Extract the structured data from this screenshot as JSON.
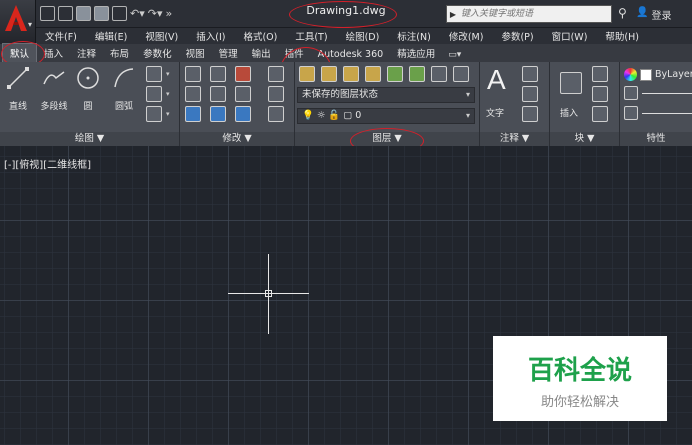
{
  "title_bar": {
    "document_title": "Drawing1.dwg",
    "search_placeholder": "键入关键字或短语",
    "login_label": "登录"
  },
  "menu": [
    "文件(F)",
    "编辑(E)",
    "视图(V)",
    "插入(I)",
    "格式(O)",
    "工具(T)",
    "绘图(D)",
    "标注(N)",
    "修改(M)",
    "参数(P)",
    "窗口(W)",
    "帮助(H)"
  ],
  "ribbon_tabs": [
    "默认",
    "插入",
    "注释",
    "布局",
    "参数化",
    "视图",
    "管理",
    "输出",
    "插件",
    "Autodesk 360",
    "精选应用"
  ],
  "active_tab": "默认",
  "draw_panel": {
    "tools": [
      "直线",
      "多段线",
      "圆",
      "圆弧"
    ],
    "footer": "绘图 ▼"
  },
  "modify_panel": {
    "footer": "修改 ▼"
  },
  "layer_panel": {
    "layer_state": "未保存的图层状态",
    "current_layer": "0",
    "footer": "图层 ▼"
  },
  "annotation_panel": {
    "text_label": "文字",
    "footer": "注释 ▼"
  },
  "block_panel": {
    "insert_label": "插入",
    "footer": "块 ▼"
  },
  "properties_panel": {
    "bylayer": "ByLayer",
    "footer": "特性"
  },
  "viewport": {
    "label": "[-][俯视][二维线框]"
  },
  "watermark": {
    "title": "百科全说",
    "subtitle": "助你轻松解决"
  },
  "colors": {
    "annotation_red": "#d3202a",
    "watermark_green": "#1ea14b",
    "canvas": "#21252c"
  }
}
